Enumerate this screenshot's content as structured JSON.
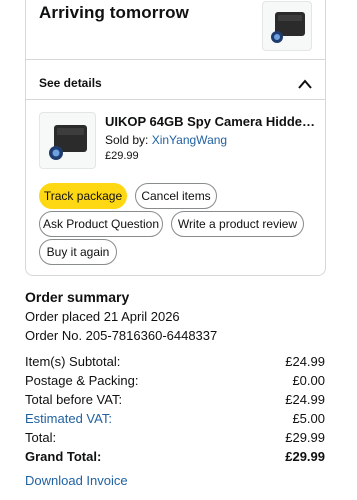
{
  "shipment": {
    "status_title": "Arriving tomorrow",
    "see_details_label": "See details",
    "expand_icon": "chevron-up-icon"
  },
  "item": {
    "title": "UIKOP 64GB Spy Camera Hidden...",
    "sold_by_prefix": "Sold by: ",
    "seller": "XinYangWang",
    "price": "£29.99",
    "image_icon": "spy-camera-product-image"
  },
  "actions": {
    "track_package": "Track package",
    "cancel_items": "Cancel items",
    "ask_question": "Ask Product Question",
    "write_review": "Write a product review",
    "buy_again": "Buy it again"
  },
  "summary": {
    "title": "Order summary",
    "order_placed": "Order placed 21 April 2026",
    "order_number": "Order No. 205-7816360-6448337",
    "rows": [
      {
        "label": "Item(s) Subtotal:",
        "value": "£24.99"
      },
      {
        "label": "Postage & Packing:",
        "value": "£0.00"
      },
      {
        "label": "Total before VAT:",
        "value": "£24.99"
      },
      {
        "label": "Estimated VAT:",
        "value": "£5.00"
      },
      {
        "label": "Total:",
        "value": "£29.99"
      },
      {
        "label": "Grand Total:",
        "value": "£29.99"
      }
    ],
    "download_invoice": "Download Invoice"
  },
  "colors": {
    "link": "#2162a1",
    "primary_button": "#ffd814",
    "border": "#d5d9d9"
  }
}
